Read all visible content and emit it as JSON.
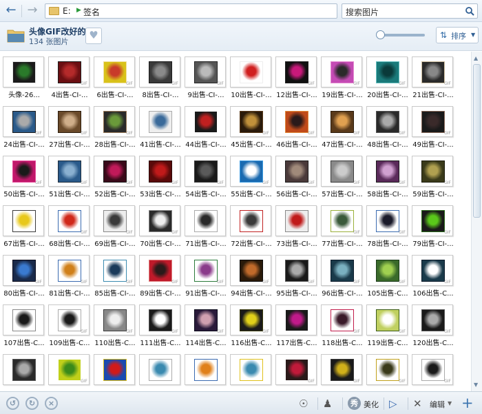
{
  "nav": {
    "back_icon": "back-arrow-icon",
    "forward_icon": "forward-arrow-icon"
  },
  "address": {
    "drive": "E:",
    "folder": "签名"
  },
  "search": {
    "placeholder": "搜索图片"
  },
  "folder": {
    "title": "头像GIF改好的",
    "count": "134 张图片"
  },
  "sort": {
    "label": "排序"
  },
  "thumbnails": [
    {
      "caption": "头像-26...",
      "colors": [
        "#1b1b1b",
        "#2a7a2a",
        "#e6e6e6"
      ],
      "gif": false
    },
    {
      "caption": "4出售-CI-...",
      "colors": [
        "#6b0f12",
        "#b42a2a",
        "#1b1b1b"
      ],
      "gif": true
    },
    {
      "caption": "6出售-CI-...",
      "colors": [
        "#d9c21a",
        "#c83a2a",
        "#f0e0a0"
      ],
      "gif": true
    },
    {
      "caption": "8出售-CI-...",
      "colors": [
        "#3a3a3a",
        "#8a8a8a",
        "#1a1a1a"
      ],
      "gif": true
    },
    {
      "caption": "9出售-CI-...",
      "colors": [
        "#555",
        "#bbb",
        "#222"
      ],
      "gif": true
    },
    {
      "caption": "10出售-CI-...",
      "colors": [
        "#ffffff",
        "#d02020",
        "#eeeeee"
      ],
      "gif": false
    },
    {
      "caption": "12出售-CI-...",
      "colors": [
        "#111",
        "#c8197a",
        "#222"
      ],
      "gif": true
    },
    {
      "caption": "19出售-CI-...",
      "colors": [
        "#c54bb5",
        "#2a2a2a",
        "#e58ad0"
      ],
      "gif": true
    },
    {
      "caption": "20出售-CI-...",
      "colors": [
        "#1a7a7a",
        "#0a3a3a",
        "#66c0c0"
      ],
      "gif": true
    },
    {
      "caption": "21出售-CI-...",
      "colors": [
        "#2a2a2a",
        "#888",
        "#d0c0a0"
      ],
      "gif": true
    },
    {
      "caption": "24出售-CI-...",
      "colors": [
        "#2a5a8a",
        "#aaaaaa",
        "#1a1a1a"
      ],
      "gif": true
    },
    {
      "caption": "27出售-CI-...",
      "colors": [
        "#6a4a2a",
        "#cfae8a",
        "#2a1a0a"
      ],
      "gif": true
    },
    {
      "caption": "28出售-CI-...",
      "colors": [
        "#2a2a2a",
        "#6a9a3a",
        "#9a7a5a"
      ],
      "gif": true
    },
    {
      "caption": "41出售-CI-...",
      "colors": [
        "#eeeeee",
        "#3a6a9a",
        "#aaaaaa"
      ],
      "gif": false
    },
    {
      "caption": "44出售-CI-...",
      "colors": [
        "#1a1a1a",
        "#c02020",
        "#ffffff"
      ],
      "gif": false
    },
    {
      "caption": "45出售-CI-...",
      "colors": [
        "#2a1a0a",
        "#c0903a",
        "#5a3a1a"
      ],
      "gif": true
    },
    {
      "caption": "46出售-CI-...",
      "colors": [
        "#c04a1a",
        "#2a1a1a",
        "#e08a3a"
      ],
      "gif": true
    },
    {
      "caption": "47出售-CI-...",
      "colors": [
        "#5a3a1a",
        "#e0a050",
        "#2a1a0a"
      ],
      "gif": true
    },
    {
      "caption": "48出售-CI-...",
      "colors": [
        "#2a2a2a",
        "#aaaaaa",
        "#555"
      ],
      "gif": true
    },
    {
      "caption": "49出售-CI-...",
      "colors": [
        "#1a1a1a",
        "#3a2a2a",
        "#8a6a5a"
      ],
      "gif": true
    },
    {
      "caption": "50出售-CI-...",
      "colors": [
        "#c0186a",
        "#1a1a1a",
        "#e84a9a"
      ],
      "gif": true
    },
    {
      "caption": "51出售-CI-...",
      "colors": [
        "#2a5a8a",
        "#8ab0d0",
        "#1a2a3a"
      ],
      "gif": true
    },
    {
      "caption": "52出售-CI-...",
      "colors": [
        "#3a0a1a",
        "#c01a5a",
        "#1a1a1a"
      ],
      "gif": true
    },
    {
      "caption": "53出售-CI-...",
      "colors": [
        "#5a0a0a",
        "#c01a1a",
        "#2a0a0a"
      ],
      "gif": true
    },
    {
      "caption": "54出售-CI-...",
      "colors": [
        "#1a1a1a",
        "#5a5a5a",
        "#3a3a3a"
      ],
      "gif": true
    },
    {
      "caption": "55出售-CI-...",
      "colors": [
        "#1a6ab0",
        "#ffffff",
        "#3a9ae0"
      ],
      "gif": true
    },
    {
      "caption": "56出售-CI-...",
      "colors": [
        "#4a3a3a",
        "#a08a7a",
        "#1a1a1a"
      ],
      "gif": true
    },
    {
      "caption": "57出售-CI-...",
      "colors": [
        "#8a8a8a",
        "#cccccc",
        "#3a3a3a"
      ],
      "gif": true
    },
    {
      "caption": "58出售-CI-...",
      "colors": [
        "#5a2a5a",
        "#d0a0d0",
        "#1a1a1a"
      ],
      "gif": true
    },
    {
      "caption": "59出售-CI-...",
      "colors": [
        "#3a3a1a",
        "#b0a050",
        "#1a1a0a"
      ],
      "gif": true
    },
    {
      "caption": "67出售-CI-...",
      "colors": [
        "#ffffff",
        "#e8c81a",
        "#3a3a3a"
      ],
      "gif": false
    },
    {
      "caption": "68出售-CI-...",
      "colors": [
        "#ffffff",
        "#d0281a",
        "#3a6ab0"
      ],
      "gif": true
    },
    {
      "caption": "69出售-CI-...",
      "colors": [
        "#eeeeee",
        "#3a3a3a",
        "#888"
      ],
      "gif": true
    },
    {
      "caption": "70出售-CI-...",
      "colors": [
        "#2a2a2a",
        "#eeeeee",
        "#888"
      ],
      "gif": true
    },
    {
      "caption": "71出售-CI-...",
      "colors": [
        "#ffffff",
        "#2a2a2a",
        "#aaaaaa"
      ],
      "gif": false
    },
    {
      "caption": "72出售-CI-...",
      "colors": [
        "#ffffff",
        "#3a3a3a",
        "#c02020"
      ],
      "gif": false
    },
    {
      "caption": "73出售-CI-...",
      "colors": [
        "#eeeeee",
        "#c01a1a",
        "#888"
      ],
      "gif": false
    },
    {
      "caption": "77出售-CI-...",
      "colors": [
        "#ffffff",
        "#3a5a3a",
        "#9ab03a"
      ],
      "gif": true
    },
    {
      "caption": "78出售-CI-...",
      "colors": [
        "#ffffff",
        "#1a1a2a",
        "#3a6ab0"
      ],
      "gif": true
    },
    {
      "caption": "79出售-CI-...",
      "colors": [
        "#1a1a1a",
        "#5ac81a",
        "#2a6a1a"
      ],
      "gif": true
    },
    {
      "caption": "80出售-CI-...",
      "colors": [
        "#1a2a4a",
        "#3a7ad0",
        "#0a0a1a"
      ],
      "gif": true
    },
    {
      "caption": "81出售-CI-...",
      "colors": [
        "#ffffff",
        "#d0801a",
        "#3a6ab0"
      ],
      "gif": true
    },
    {
      "caption": "85出售-CI-...",
      "colors": [
        "#ffffff",
        "#1a3a5a",
        "#3a8ab0"
      ],
      "gif": true
    },
    {
      "caption": "89出售-CI-...",
      "colors": [
        "#c01a2a",
        "#2a1a1a",
        "#e08080"
      ],
      "gif": true
    },
    {
      "caption": "91出售-CI-...",
      "colors": [
        "#ffffff",
        "#8a3a8a",
        "#2a7a3a"
      ],
      "gif": true
    },
    {
      "caption": "94出售-CI-...",
      "colors": [
        "#2a1a0a",
        "#c06a2a",
        "#0a0a0a"
      ],
      "gif": true
    },
    {
      "caption": "95出售-CI-...",
      "colors": [
        "#1a1a1a",
        "#aaaaaa",
        "#555"
      ],
      "gif": true
    },
    {
      "caption": "96出售-CI-...",
      "colors": [
        "#1a3a4a",
        "#7ab0c0",
        "#0a1a2a"
      ],
      "gif": true
    },
    {
      "caption": "105出售-C...",
      "colors": [
        "#3a6a2a",
        "#a0d050",
        "#1a3a1a"
      ],
      "gif": true
    },
    {
      "caption": "106出售-C...",
      "colors": [
        "#1a3a4a",
        "#ffffff",
        "#0a1a2a"
      ],
      "gif": true
    },
    {
      "caption": "107出售-C...",
      "colors": [
        "#ffffff",
        "#1a1a1a",
        "#888"
      ],
      "gif": false
    },
    {
      "caption": "109出售-C...",
      "colors": [
        "#ffffff",
        "#1a1a1a",
        "#aaaaaa"
      ],
      "gif": true
    },
    {
      "caption": "110出售-C...",
      "colors": [
        "#888",
        "#eeeeee",
        "#3a3a3a"
      ],
      "gif": true
    },
    {
      "caption": "111出售-C...",
      "colors": [
        "#1a1a1a",
        "#ffffff",
        "#555"
      ],
      "gif": true
    },
    {
      "caption": "114出售-C...",
      "colors": [
        "#2a1a3a",
        "#d0a0b0",
        "#0a0a1a"
      ],
      "gif": true
    },
    {
      "caption": "116出售-C...",
      "colors": [
        "#1a1a1a",
        "#e0d01a",
        "#3a3a0a"
      ],
      "gif": true
    },
    {
      "caption": "117出售-C...",
      "colors": [
        "#1a1a1a",
        "#c01a8a",
        "#ffffff"
      ],
      "gif": false
    },
    {
      "caption": "118出售-C...",
      "colors": [
        "#ffffff",
        "#3a1a2a",
        "#c01a4a"
      ],
      "gif": true
    },
    {
      "caption": "119出售-C...",
      "colors": [
        "#c0d060",
        "#ffffff",
        "#3a5a1a"
      ],
      "gif": true
    },
    {
      "caption": "120出售-C...",
      "colors": [
        "#1a1a1a",
        "#aaaaaa",
        "#555"
      ],
      "gif": true
    },
    {
      "caption": "",
      "colors": [
        "#2a2a2a",
        "#aaaaaa",
        "#555"
      ],
      "gif": false
    },
    {
      "caption": "",
      "colors": [
        "#c0d01a",
        "#3a8a1a",
        "#ffffff"
      ],
      "gif": true
    },
    {
      "caption": "",
      "colors": [
        "#1a4ab0",
        "#d01a1a",
        "#e0c01a"
      ],
      "gif": false
    },
    {
      "caption": "",
      "colors": [
        "#ffffff",
        "#3a8ab0",
        "#aaaaaa"
      ],
      "gif": false
    },
    {
      "caption": "",
      "colors": [
        "#ffffff",
        "#e0801a",
        "#3a6ab0"
      ],
      "gif": false
    },
    {
      "caption": "",
      "colors": [
        "#ffffff",
        "#3a8ab0",
        "#e0c01a"
      ],
      "gif": false
    },
    {
      "caption": "",
      "colors": [
        "#2a1a1a",
        "#c01a3a",
        "#ffffff"
      ],
      "gif": true
    },
    {
      "caption": "",
      "colors": [
        "#1a1a1a",
        "#d0b01a",
        "#3a3a3a"
      ],
      "gif": true
    },
    {
      "caption": "",
      "colors": [
        "#ffffff",
        "#3a3a1a",
        "#c0a01a"
      ],
      "gif": true
    },
    {
      "caption": "",
      "colors": [
        "#ffffff",
        "#1a1a1a",
        "#aaaaaa"
      ],
      "gif": true
    }
  ],
  "gif_label": "GIF",
  "bottom": {
    "beautify_label": "美化",
    "edit_label": "编辑"
  }
}
